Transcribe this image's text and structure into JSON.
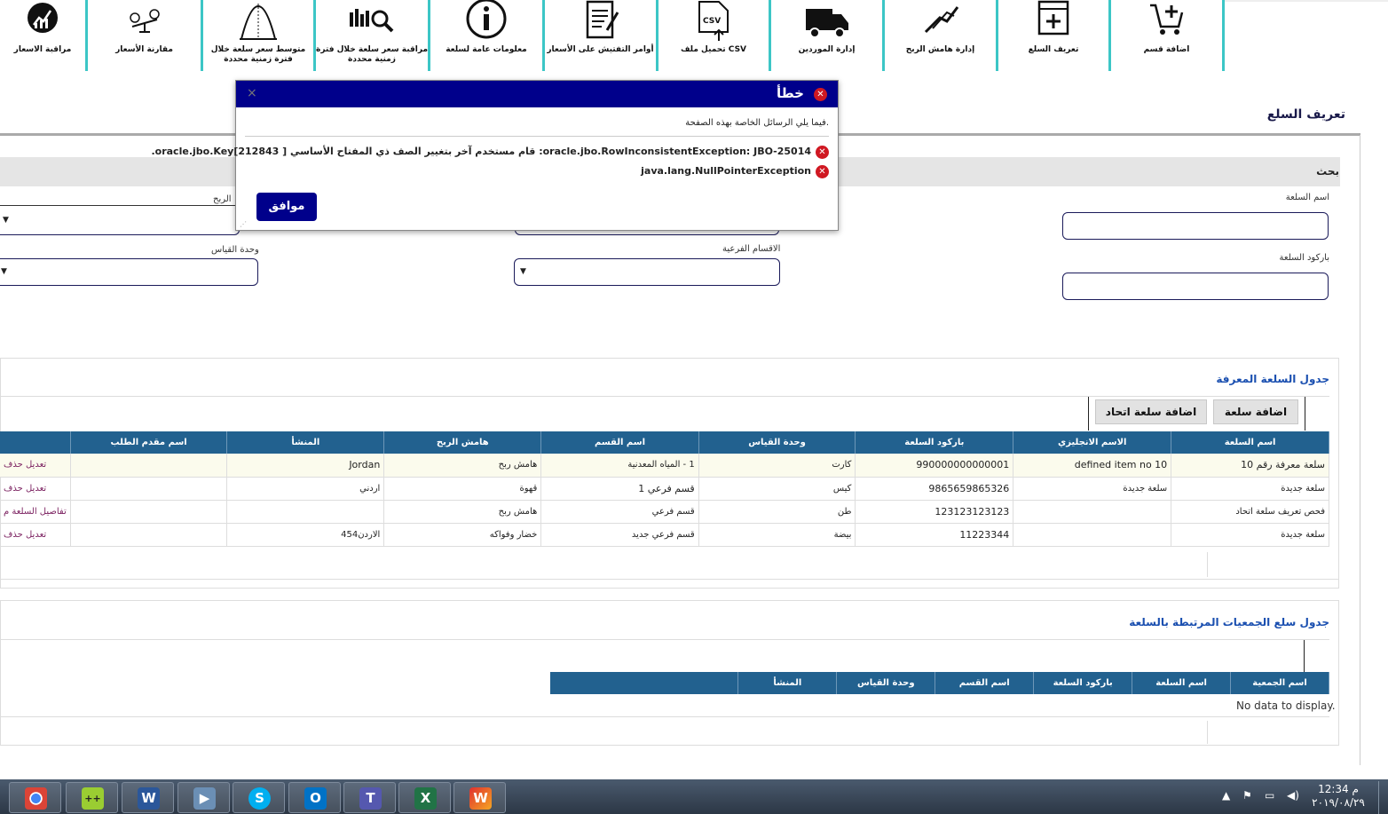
{
  "toolbar": {
    "items": [
      {
        "label": "مراقبة الاسعار",
        "icon": "price-monitor-icon"
      },
      {
        "label": "مقارنة الأسعار",
        "icon": "price-compare-icon"
      },
      {
        "label": "متوسط سعر سلعة خلال فترة زمنية محددة",
        "icon": "average-price-icon"
      },
      {
        "label": "مراقبة سعر سلعة خلال فترة زمنية محددة",
        "icon": "price-watch-icon"
      },
      {
        "label": "معلومات عامة لسلعة",
        "icon": "info-icon"
      },
      {
        "label": "أوامر التفتيش على الأسعار",
        "icon": "inspection-orders-icon"
      },
      {
        "label": "تحميل ملف CSV",
        "icon": "csv-upload-icon"
      },
      {
        "label": "إدارة الموردين",
        "icon": "truck-icon"
      },
      {
        "label": "إدارة هامش الربح",
        "icon": "profit-margin-icon"
      },
      {
        "label": "تعريف السلع",
        "icon": "define-item-icon"
      },
      {
        "label": "اضافة قسم",
        "icon": "cart-add-icon"
      }
    ]
  },
  "page": {
    "title": "تعريف السلع"
  },
  "search": {
    "label": "بحث",
    "item_name_label": "اسم السلعة",
    "item_barcode_label": "باركود السلعة",
    "subsection_label": "الاقسام الفرعية",
    "unit_label": "وحدة القياس",
    "margin_label": "الربح"
  },
  "items_table": {
    "title": "جدول السلعة المعرفة",
    "add_item_button": "اضافة سلعة",
    "add_union_item_button": "اضافة سلعة اتحاد",
    "columns": [
      "اسم السلعة",
      "الاسم الانجليزي",
      "باركود السلعة",
      "وحدة القياس",
      "اسم القسم",
      "هامش الربح",
      "المنشأ",
      "اسم مقدم الطلب"
    ],
    "rows": [
      {
        "cells": [
          "سلعة معرفة رقم 10",
          "defined item no 10",
          "990000000000001",
          "كارت",
          "1 - المياه المعدنية",
          "هامش ربح",
          "Jordan",
          ""
        ],
        "actions": "تعديل  حذف"
      },
      {
        "cells": [
          "سلعة جديدة",
          "سلعة جديدة",
          "9865659865326",
          "كيس",
          "قسم فرعي 1",
          "قهوة",
          "اردني",
          ""
        ],
        "actions": "تعديل  حذف"
      },
      {
        "cells": [
          "فحص تعريف سلعة اتحاد",
          "",
          "123123123123",
          "طن",
          "قسم فرعي",
          "هامش ربح",
          "",
          ""
        ],
        "actions": "تفاصيل السلعة م"
      },
      {
        "cells": [
          "سلعة جديدة",
          "",
          "11223344",
          "بيضة",
          "قسم فرعي جديد",
          "خضار وفواكه",
          "الاردن454",
          ""
        ],
        "actions": "تعديل  حذف"
      }
    ]
  },
  "assoc_table": {
    "title": "جدول سلع الجمعيات المرتبطة بالسلعة",
    "columns": [
      "اسم الجمعية",
      "اسم السلعة",
      "باركود السلعة",
      "اسم القسم",
      "وحدة القياس",
      "المنشأ"
    ],
    "empty_text": "No data to display."
  },
  "dialog": {
    "title": "خطأ",
    "subtitle": "فيما يلي الرسائل الخاصة بهذه الصفحة.",
    "messages": [
      "oracle.jbo.RowInconsistentException: JBO-25014: قام مستخدم آخر بتغيير الصف ذي المفتاح الأساسي oracle.jbo.Key[212843 ].",
      "java.lang.NullPointerException"
    ],
    "ok_button": "موافق",
    "close_symbol": "×"
  },
  "taskbar": {
    "apps": [
      "Chrome",
      "Notepad++",
      "Word",
      "Media",
      "Skype",
      "Outlook",
      "Teams",
      "Excel",
      "App"
    ],
    "time": "12:34 م",
    "date": "٢٠١٩/٠٨/٢٩"
  },
  "colors": {
    "header_bg": "#22618f",
    "dialog_bg": "#00008b",
    "accent": "#3cc6c6",
    "error": "#d01822"
  }
}
